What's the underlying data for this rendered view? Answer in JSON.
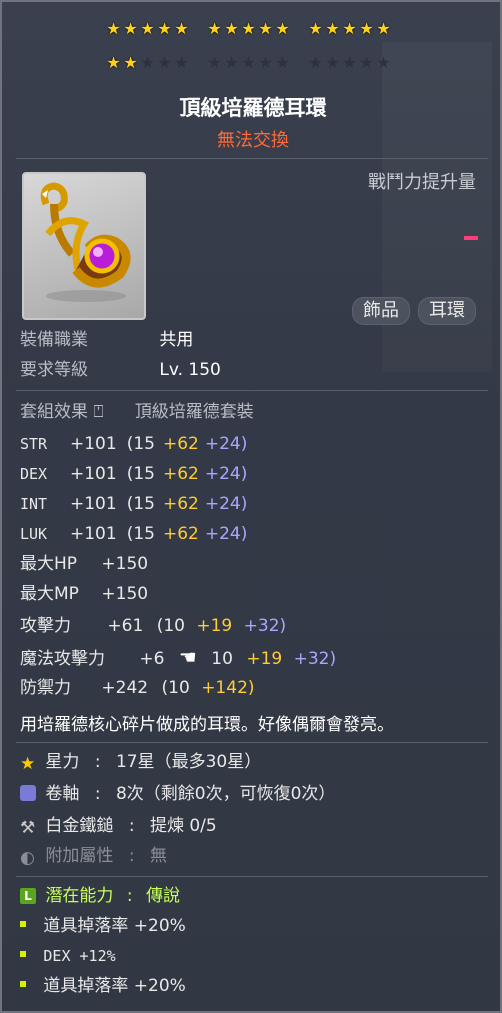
{
  "stars": {
    "rows": [
      [
        5,
        5,
        5
      ],
      [
        2,
        0,
        0
      ]
    ],
    "per_group": 5
  },
  "item": {
    "name": "頂級培羅德耳環",
    "trade": "無法交換"
  },
  "power": {
    "label": "戰鬥力提升量",
    "bar_color": "#ff3d7a"
  },
  "tags": [
    "飾品",
    "耳環"
  ],
  "requirements": [
    {
      "label": "裝備職業",
      "value": "共用"
    },
    {
      "label": "要求等級",
      "value": "Lv. 150"
    }
  ],
  "set": {
    "label": "套組效果",
    "value": "頂級培羅德套裝"
  },
  "stats": [
    {
      "name": "STR",
      "total": "+101",
      "base": "(15",
      "a": "+62",
      "b": "+24)"
    },
    {
      "name": "DEX",
      "total": "+101",
      "base": "(15",
      "a": "+62",
      "b": "+24)"
    },
    {
      "name": "INT",
      "total": "+101",
      "base": "(15",
      "a": "+62",
      "b": "+24)"
    },
    {
      "name": "LUK",
      "total": "+101",
      "base": "(15",
      "a": "+62",
      "b": "+24)"
    }
  ],
  "simple_stats": [
    {
      "name": "最大HP",
      "value": "+150"
    },
    {
      "name": "最大MP",
      "value": "+150"
    }
  ],
  "attack": {
    "name": "攻擊力",
    "total": "+61",
    "base": "(10",
    "a": "+19",
    "b": "+32)"
  },
  "magic": {
    "name": "魔法攻擊力",
    "total": "+6",
    "base": "10",
    "a": "+19",
    "b": "+32)"
  },
  "defense": {
    "name": "防禦力",
    "total": "+242",
    "base": "(10",
    "a": "+142)"
  },
  "description": "用培羅德核心碎片做成的耳環。好像偶爾會發亮。",
  "enhance": [
    {
      "icon": "star-icon",
      "label": "星力",
      "value": "17星（最多30星）"
    },
    {
      "icon": "scroll-icon",
      "label": "卷軸",
      "value": "8次（剩餘0次，可恢復0次）"
    },
    {
      "icon": "hammer-icon",
      "label": "白金鐵鎚",
      "value": "提煉 0/5"
    },
    {
      "icon": "soul-icon",
      "label": "附加屬性",
      "value": "無"
    }
  ],
  "potential": {
    "label": "潛在能力",
    "grade": "傳說",
    "lines": [
      "道具掉落率 +20%",
      "DEX +12%",
      "道具掉落率 +20%"
    ]
  }
}
